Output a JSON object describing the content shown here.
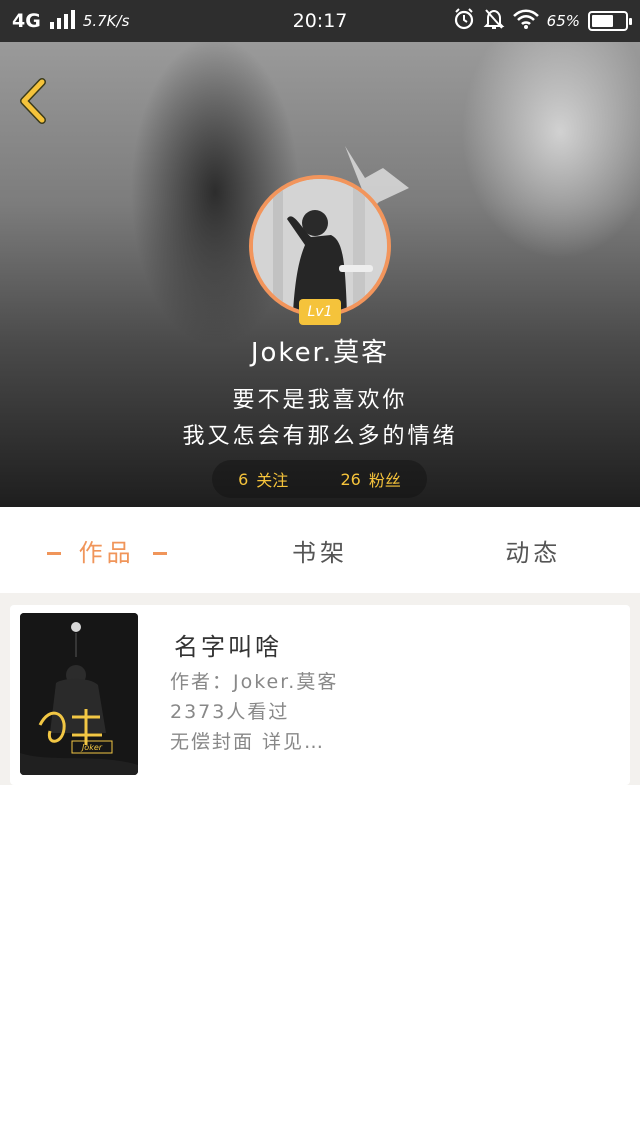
{
  "status_bar": {
    "network": "4G",
    "speed": "5.7K/s",
    "time": "20:17",
    "battery_text": "65%",
    "battery_level": 0.65
  },
  "profile": {
    "level": "Lv1",
    "name": "Joker.莫客",
    "bio_line1": "要不是我喜欢你",
    "bio_line2": "我又怎会有那么多的情绪",
    "following_count": "6",
    "following_label": "关注",
    "fans_count": "26",
    "fans_label": "粉丝"
  },
  "tabs": [
    {
      "label": "作品",
      "active": true
    },
    {
      "label": "书架",
      "active": false
    },
    {
      "label": "动态",
      "active": false
    }
  ],
  "works": [
    {
      "title": "名字叫啥",
      "author": "作者：Joker.莫客",
      "views": "2373人看过",
      "desc": "无偿封面 详见…",
      "cover_text": "Joker"
    }
  ],
  "colors": {
    "accent": "#f0955a",
    "gold": "#f5c33b"
  }
}
